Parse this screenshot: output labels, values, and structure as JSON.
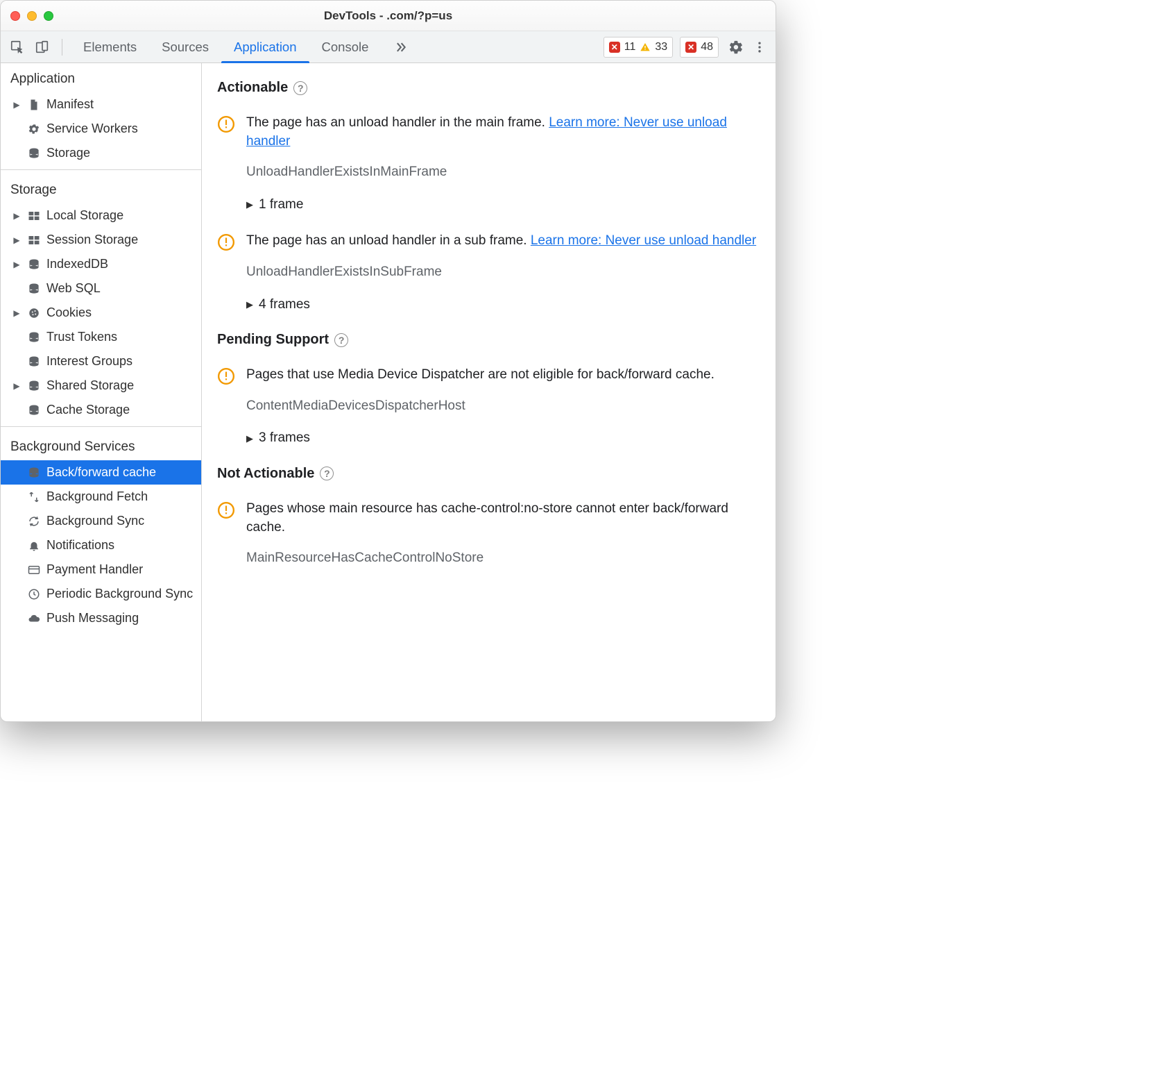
{
  "window": {
    "title": "DevTools -          .com/?p=us"
  },
  "toolbar": {
    "tabs": [
      {
        "label": "Elements",
        "active": false
      },
      {
        "label": "Sources",
        "active": false
      },
      {
        "label": "Application",
        "active": true
      },
      {
        "label": "Console",
        "active": false
      }
    ],
    "errors": "11",
    "warnings": "33",
    "issues": "48"
  },
  "sidebar": {
    "sections": [
      {
        "title": "Application",
        "items": [
          {
            "label": "Manifest",
            "icon": "file",
            "expandable": true
          },
          {
            "label": "Service Workers",
            "icon": "gear",
            "expandable": false
          },
          {
            "label": "Storage",
            "icon": "db",
            "expandable": false
          }
        ]
      },
      {
        "title": "Storage",
        "items": [
          {
            "label": "Local Storage",
            "icon": "grid",
            "expandable": true
          },
          {
            "label": "Session Storage",
            "icon": "grid",
            "expandable": true
          },
          {
            "label": "IndexedDB",
            "icon": "db",
            "expandable": true
          },
          {
            "label": "Web SQL",
            "icon": "db",
            "expandable": false
          },
          {
            "label": "Cookies",
            "icon": "cookie",
            "expandable": true
          },
          {
            "label": "Trust Tokens",
            "icon": "db",
            "expandable": false
          },
          {
            "label": "Interest Groups",
            "icon": "db",
            "expandable": false
          },
          {
            "label": "Shared Storage",
            "icon": "db",
            "expandable": true
          },
          {
            "label": "Cache Storage",
            "icon": "db",
            "expandable": false
          }
        ]
      },
      {
        "title": "Background Services",
        "items": [
          {
            "label": "Back/forward cache",
            "icon": "db",
            "selected": true
          },
          {
            "label": "Background Fetch",
            "icon": "fetch"
          },
          {
            "label": "Background Sync",
            "icon": "sync"
          },
          {
            "label": "Notifications",
            "icon": "bell"
          },
          {
            "label": "Payment Handler",
            "icon": "card"
          },
          {
            "label": "Periodic Background Sync",
            "icon": "clock"
          },
          {
            "label": "Push Messaging",
            "icon": "cloud"
          }
        ]
      }
    ]
  },
  "content": {
    "groups": [
      {
        "title": "Actionable",
        "issues": [
          {
            "text": "The page has an unload handler in the main frame. ",
            "link": "Learn more: Never use unload handler",
            "code": "UnloadHandlerExistsInMainFrame",
            "frames": "1 frame"
          },
          {
            "text": "The page has an unload handler in a sub frame. ",
            "link": "Learn more: Never use unload handler",
            "code": "UnloadHandlerExistsInSubFrame",
            "frames": "4 frames"
          }
        ]
      },
      {
        "title": "Pending Support",
        "issues": [
          {
            "text": "Pages that use Media Device Dispatcher are not eligible for back/forward cache.",
            "code": "ContentMediaDevicesDispatcherHost",
            "frames": "3 frames"
          }
        ]
      },
      {
        "title": "Not Actionable",
        "issues": [
          {
            "text": "Pages whose main resource has cache-control:no-store cannot enter back/forward cache.",
            "code": "MainResourceHasCacheControlNoStore"
          }
        ]
      }
    ]
  }
}
